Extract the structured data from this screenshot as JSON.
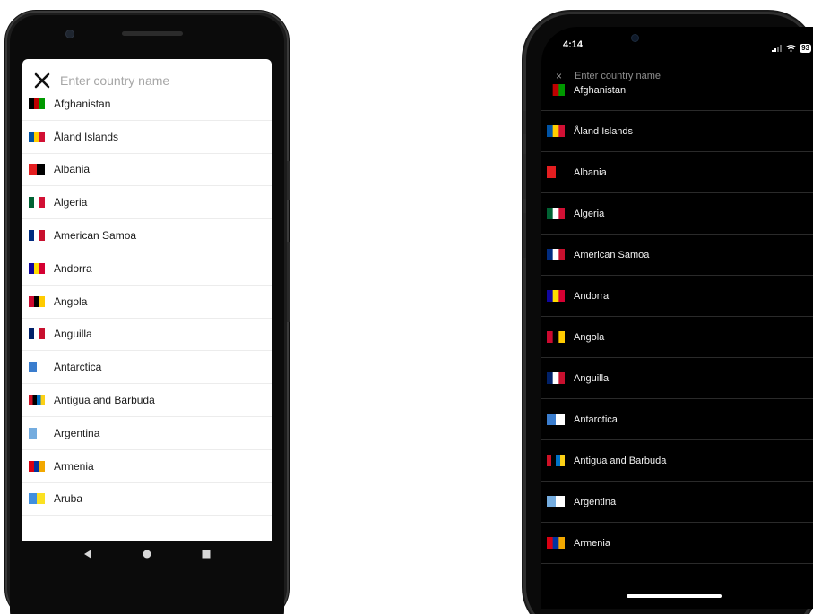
{
  "android": {
    "search": {
      "placeholder": "Enter country name"
    },
    "countries": [
      {
        "name": "Afghanistan",
        "flag": "afghanistan-flag-icon",
        "colors": [
          "#000000",
          "#be0000",
          "#009900"
        ]
      },
      {
        "name": "Åland Islands",
        "flag": "aland-islands-flag-icon",
        "colors": [
          "#0053a5",
          "#ffce00",
          "#d21034"
        ]
      },
      {
        "name": "Albania",
        "flag": "albania-flag-icon",
        "colors": [
          "#e41e20",
          "#000000"
        ]
      },
      {
        "name": "Algeria",
        "flag": "algeria-flag-icon",
        "colors": [
          "#006233",
          "#ffffff",
          "#d21034"
        ]
      },
      {
        "name": "American Samoa",
        "flag": "american-samoa-flag-icon",
        "colors": [
          "#002b7f",
          "#ffffff",
          "#c8102e"
        ]
      },
      {
        "name": "Andorra",
        "flag": "andorra-flag-icon",
        "colors": [
          "#10069f",
          "#fedd00",
          "#d50032"
        ]
      },
      {
        "name": "Angola",
        "flag": "angola-flag-icon",
        "colors": [
          "#cc092f",
          "#000000",
          "#ffcb00"
        ]
      },
      {
        "name": "Anguilla",
        "flag": "anguilla-flag-icon",
        "colors": [
          "#012169",
          "#ffffff",
          "#c8102e"
        ]
      },
      {
        "name": "Antarctica",
        "flag": "antarctica-flag-icon",
        "colors": [
          "#3a7dce",
          "#ffffff"
        ]
      },
      {
        "name": "Antigua and Barbuda",
        "flag": "antigua-and-barbuda-flag-icon",
        "colors": [
          "#ce1126",
          "#000000",
          "#0072c6",
          "#fcd116"
        ]
      },
      {
        "name": "Argentina",
        "flag": "argentina-flag-icon",
        "colors": [
          "#74acdf",
          "#ffffff"
        ]
      },
      {
        "name": "Armenia",
        "flag": "armenia-flag-icon",
        "colors": [
          "#d90012",
          "#0033a0",
          "#f2a800"
        ]
      },
      {
        "name": "Aruba",
        "flag": "aruba-flag-icon",
        "colors": [
          "#418fde",
          "#fbe122"
        ]
      }
    ]
  },
  "ios": {
    "status": {
      "time": "4:14",
      "battery": "93"
    },
    "search": {
      "close": "×",
      "placeholder": "Enter country name"
    },
    "countries": [
      {
        "name": "Afghanistan",
        "flag": "afghanistan-flag-icon",
        "colors": [
          "#000000",
          "#be0000",
          "#009900"
        ]
      },
      {
        "name": "Åland Islands",
        "flag": "aland-islands-flag-icon",
        "colors": [
          "#0053a5",
          "#ffce00",
          "#d21034"
        ]
      },
      {
        "name": "Albania",
        "flag": "albania-flag-icon",
        "colors": [
          "#e41e20",
          "#000000"
        ]
      },
      {
        "name": "Algeria",
        "flag": "algeria-flag-icon",
        "colors": [
          "#006233",
          "#ffffff",
          "#d21034"
        ]
      },
      {
        "name": "American Samoa",
        "flag": "american-samoa-flag-icon",
        "colors": [
          "#002b7f",
          "#ffffff",
          "#c8102e"
        ]
      },
      {
        "name": "Andorra",
        "flag": "andorra-flag-icon",
        "colors": [
          "#10069f",
          "#fedd00",
          "#d50032"
        ]
      },
      {
        "name": "Angola",
        "flag": "angola-flag-icon",
        "colors": [
          "#cc092f",
          "#000000",
          "#ffcb00"
        ]
      },
      {
        "name": "Anguilla",
        "flag": "anguilla-flag-icon",
        "colors": [
          "#012169",
          "#ffffff",
          "#c8102e"
        ]
      },
      {
        "name": "Antarctica",
        "flag": "antarctica-flag-icon",
        "colors": [
          "#3a7dce",
          "#ffffff"
        ]
      },
      {
        "name": "Antigua and Barbuda",
        "flag": "antigua-and-barbuda-flag-icon",
        "colors": [
          "#ce1126",
          "#000000",
          "#0072c6",
          "#fcd116"
        ]
      },
      {
        "name": "Argentina",
        "flag": "argentina-flag-icon",
        "colors": [
          "#74acdf",
          "#ffffff"
        ]
      },
      {
        "name": "Armenia",
        "flag": "armenia-flag-icon",
        "colors": [
          "#d90012",
          "#0033a0",
          "#f2a800"
        ]
      }
    ]
  }
}
